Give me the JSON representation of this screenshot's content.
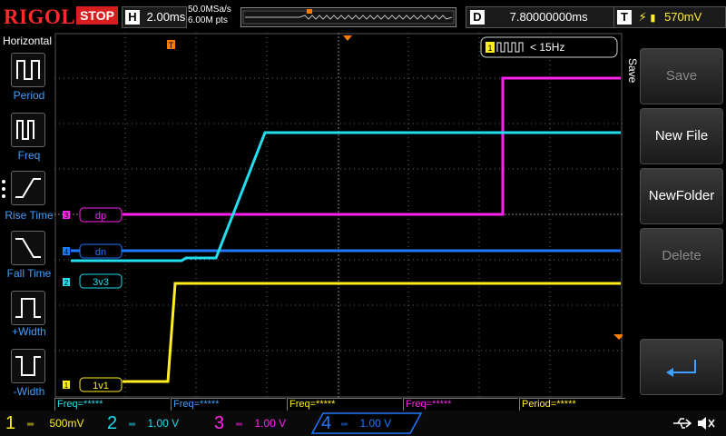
{
  "header": {
    "brand": "RIGOL",
    "run_state": "STOP",
    "h_label": "H",
    "timebase": "2.00ms",
    "sample_rate": "50.0MSa/s",
    "memory_depth": "6.00M pts",
    "delay_label": "D",
    "delay": "7.80000000ms",
    "trigger_label": "T",
    "trigger_level": "570mV",
    "trigger_marker": "T"
  },
  "left_panel": {
    "title": "Horizontal",
    "items": [
      {
        "label": "Period"
      },
      {
        "label": "Freq"
      },
      {
        "label": "Rise Time"
      },
      {
        "label": "Fall Time"
      },
      {
        "label": "+Width"
      },
      {
        "label": "-Width"
      }
    ]
  },
  "waveform": {
    "counter_channel": "1",
    "counter_text": "< 15Hz",
    "labels": [
      {
        "channel": "3",
        "name": "dp",
        "color": "#ff22ee"
      },
      {
        "channel": "4",
        "name": "dn",
        "color": "#2277ff"
      },
      {
        "channel": "2",
        "name": "3v3",
        "color": "#22ddee"
      },
      {
        "channel": "1",
        "name": "1v1",
        "color": "#ffee22"
      }
    ]
  },
  "right_menu": {
    "tab": "Save",
    "buttons": [
      {
        "label": "Save",
        "enabled": false
      },
      {
        "label": "New File",
        "enabled": true
      },
      {
        "label": "NewFolder",
        "enabled": true
      },
      {
        "label": "Delete",
        "enabled": false
      },
      {
        "label": "",
        "icon": "return-arrow-icon",
        "enabled": true
      }
    ]
  },
  "measurements": [
    {
      "text": "Freq=*****",
      "color": "#22ddee"
    },
    {
      "text": "Freq=*****",
      "color": "#3fa0ff"
    },
    {
      "text": "Freq=*****",
      "color": "#ffee22"
    },
    {
      "text": "Freq=*****",
      "color": "#ff22ee"
    },
    {
      "text": "Period=*****",
      "color": "#ffee22"
    }
  ],
  "channels": [
    {
      "number": "1",
      "scale": "500mV",
      "color": "#ffee22"
    },
    {
      "number": "2",
      "scale": "1.00 V",
      "color": "#22ddee"
    },
    {
      "number": "3",
      "scale": "1.00 V",
      "color": "#ff22ee"
    },
    {
      "number": "4",
      "scale": "1.00 V",
      "color": "#2277ff"
    }
  ],
  "status_icons": [
    "usb-icon",
    "mute-speaker-icon"
  ]
}
